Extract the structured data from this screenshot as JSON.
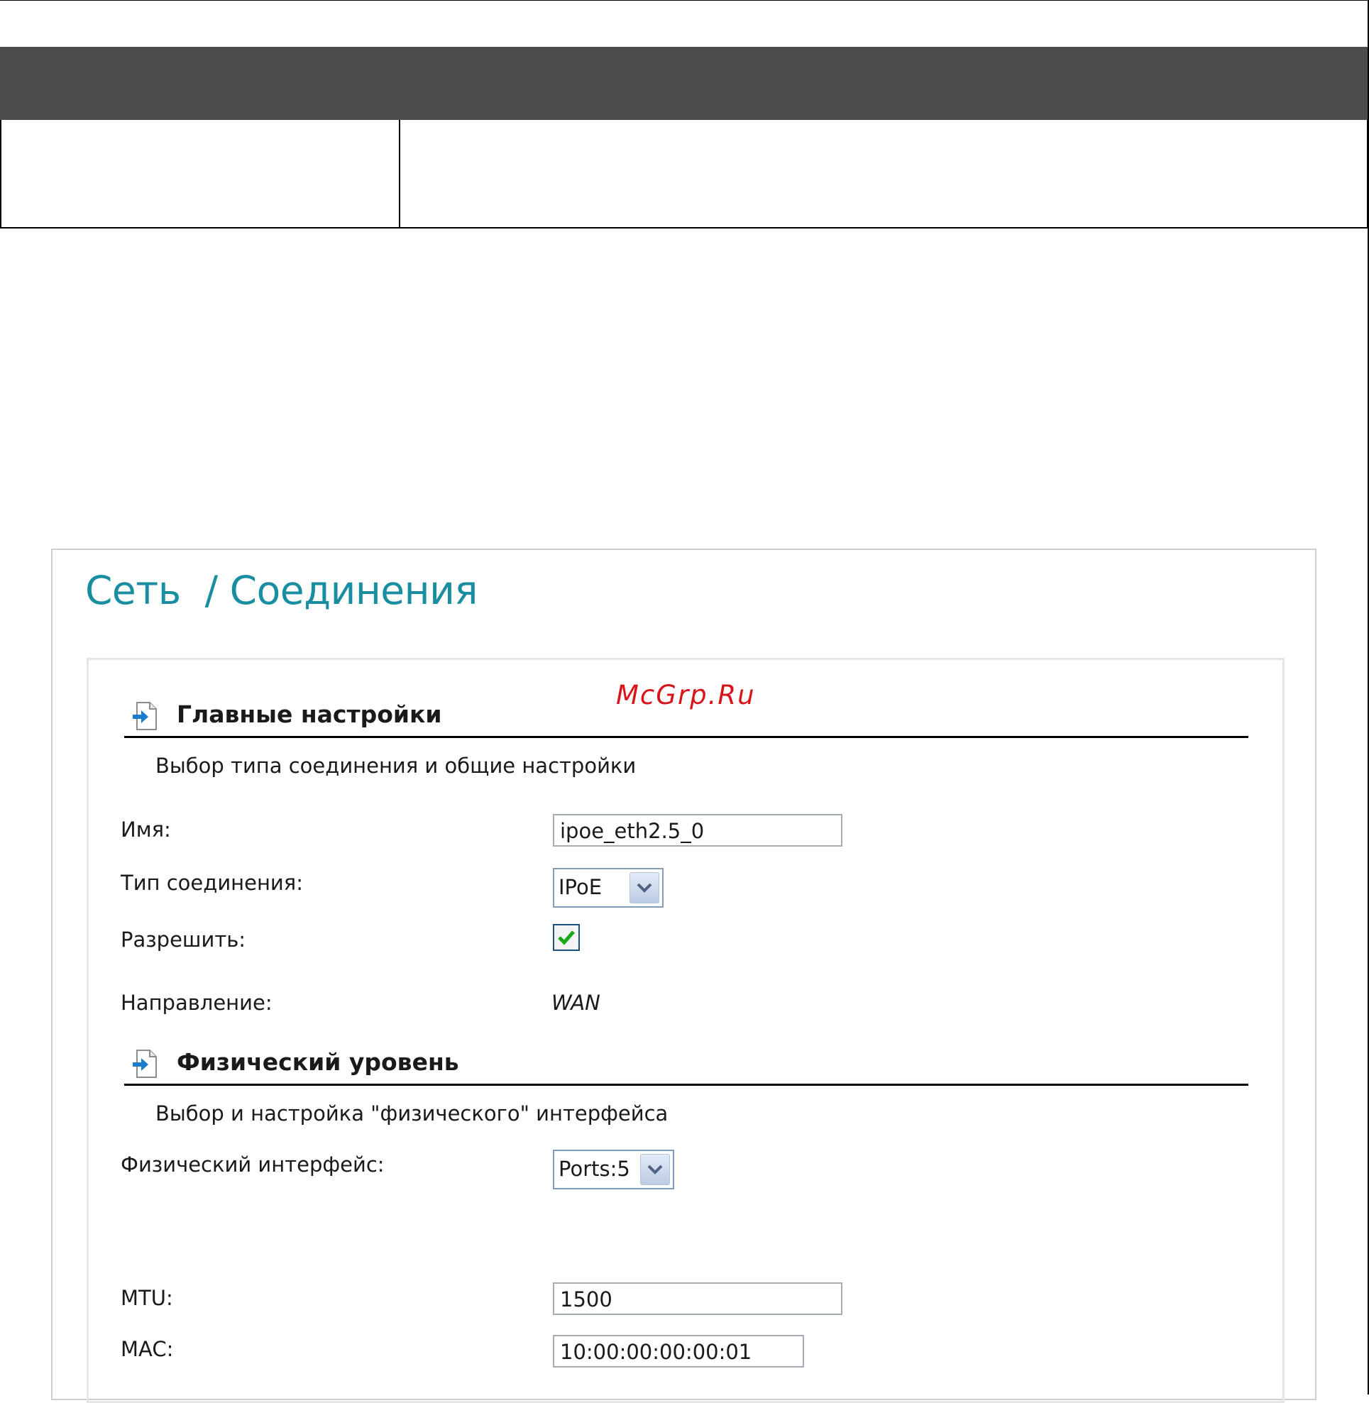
{
  "page": {
    "title": "Сеть  / Соединения",
    "watermark": "McGrp.Ru"
  },
  "main_settings": {
    "title": "Главные настройки",
    "description": "Выбор типа соединения и общие настройки",
    "icon": "page-arrow-icon",
    "name_label": "Имя:",
    "name_value": "ipoe_eth2.5_0",
    "type_label": "Тип соединения:",
    "type_value": "IPoE",
    "enable_label": "Разрешить:",
    "enable_checked": true,
    "direction_label": "Направление:",
    "direction_value": "WAN"
  },
  "physical": {
    "title": "Физический уровень",
    "description": "Выбор и настройка \"физического\" интерфейса",
    "icon": "page-arrow-icon",
    "interface_label": "Физический интерфейс:",
    "interface_value": "Ports:5",
    "mtu_label": "MTU:",
    "mtu_value": "1500",
    "mac_label": "MAC:",
    "mac_value": "10:00:00:00:00:01"
  },
  "colors": {
    "title": "#1a8ea1",
    "table_header": "#4d4d4d",
    "watermark": "#d8141b",
    "checkmark": "#1aa81a"
  }
}
